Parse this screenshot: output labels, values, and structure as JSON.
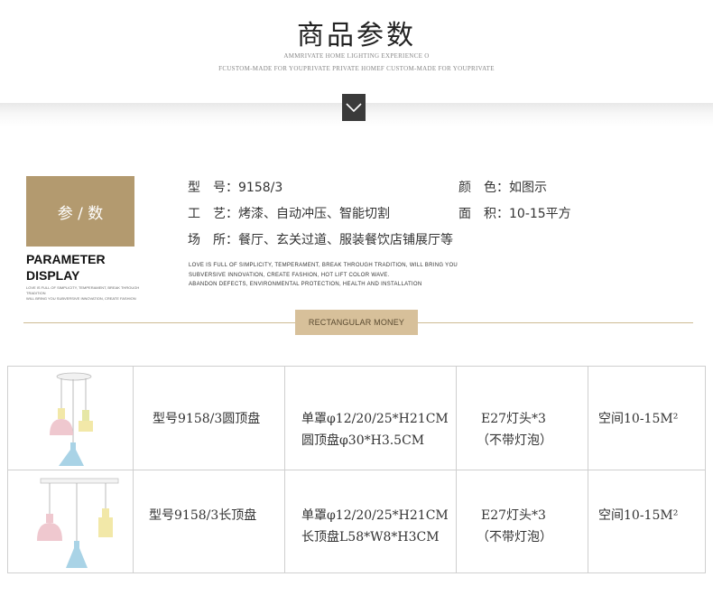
{
  "header": {
    "title": "商品参数",
    "sub1": "AMMRIVATE HOME LIGHTING EXPERIENCE O",
    "sub2": "FCUSTOM-MADE FOR YOUPRIVATE PRIVATE HOMEF CUSTOM-MADE FOR YOUPRIVATE"
  },
  "param": {
    "box_label": "参 / 数",
    "en_line1": "PARAMETER",
    "en_line2": "DISPLAY",
    "tiny_line1": "LOVE IS FULL OF SIMPLICITY, TEMPERAMENT, BREAK THROUGH TRADITION",
    "tiny_line2": "WILL BRING YOU SUBVERSIVE INNOVATION, CREATE FASHION"
  },
  "specs": {
    "model_label": "型　号：",
    "model_value": "9158/3",
    "color_label": "颜　色：",
    "color_value": "如图示",
    "craft_label": "工　艺：",
    "craft_value": "烤漆、自动冲压、智能切割",
    "area_label": "面　积：",
    "area_value": "10-15平方",
    "place_label": "场　所：",
    "place_value": "餐厅、玄关过道、服装餐饮店铺展厅等"
  },
  "description": {
    "line1": "LOVE IS FULL OF SIMPLICITY, TEMPERAMENT, BREAK THROUGH TRADITION, WILL BRING YOU",
    "line2": "SUBVERSIVE INNOVATION, CREATE FASHION, HOT LIFT COLOR WAVE.",
    "line3": "ABANDON DEFECTS, ENVIRONMENTAL PROTECTION, HEALTH AND INSTALLATION"
  },
  "badge": "RECTANGULAR MONEY",
  "table": {
    "rows": [
      {
        "model": "型号9158/3圆顶盘",
        "size_line1": "单罩φ12/20/25*H21CM",
        "size_line2": "圆顶盘φ30*H3.5CM",
        "bulb_line1": "E27灯头*3",
        "bulb_line2": "（不带灯泡）",
        "space": "空间10-15M²"
      },
      {
        "model": "型号9158/3长顶盘",
        "size_line1": "单罩φ12/20/25*H21CM",
        "size_line2": "长顶盘L58*W8*H3CM",
        "bulb_line1": "E27灯头*3",
        "bulb_line2": "（不带灯泡）",
        "space": "空间10-15M²"
      }
    ]
  },
  "colors": {
    "gold": "#b39a6f",
    "badge": "#d7c09a",
    "pink": "#efc8cf",
    "yellow": "#f2e8a8",
    "blue": "#a9d3e6"
  }
}
